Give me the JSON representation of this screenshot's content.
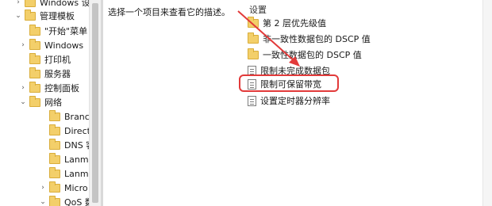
{
  "tree": {
    "items": [
      {
        "label": "Windows 设",
        "chevron": ">",
        "icon": "folder-icon"
      },
      {
        "label": "管理模板",
        "chevron": "v",
        "icon": "folder-icon"
      },
      {
        "label": "\"开始\"菜单",
        "chevron": "",
        "icon": "folder-icon"
      },
      {
        "label": "Windows",
        "chevron": ">",
        "icon": "folder-icon"
      },
      {
        "label": "打印机",
        "chevron": "",
        "icon": "folder-icon"
      },
      {
        "label": "服务器",
        "chevron": "",
        "icon": "folder-icon"
      },
      {
        "label": "控制面板",
        "chevron": ">",
        "icon": "folder-icon"
      },
      {
        "label": "网络",
        "chevron": "v",
        "icon": "folder-icon"
      },
      {
        "label": "Branc",
        "chevron": "",
        "icon": "folder-icon"
      },
      {
        "label": "Direct",
        "chevron": "",
        "icon": "folder-icon"
      },
      {
        "label": "DNS 客",
        "chevron": "",
        "icon": "folder-icon"
      },
      {
        "label": "Lanma",
        "chevron": "",
        "icon": "folder-icon"
      },
      {
        "label": "Lanma",
        "chevron": "",
        "icon": "folder-icon"
      },
      {
        "label": "Micro",
        "chevron": ">",
        "icon": "folder-icon"
      },
      {
        "label": "QoS 数",
        "chevron": "v",
        "icon": "folder-icon"
      }
    ]
  },
  "description": {
    "text": "选择一个项目来查看它的描述。"
  },
  "settings": {
    "header": "设置",
    "items": [
      {
        "label": "第 2 层优先级值",
        "icon": "folder-icon"
      },
      {
        "label": "非一致性数据包的 DSCP 值",
        "icon": "folder-icon"
      },
      {
        "label": "一致性数据包的 DSCP 值",
        "icon": "folder-icon"
      },
      {
        "label": "限制未完成数据包",
        "icon": "policy-setting-icon"
      },
      {
        "label": "限制可保留带宽",
        "icon": "policy-setting-icon"
      },
      {
        "label": "设置定时器分辨率",
        "icon": "policy-setting-icon"
      }
    ]
  },
  "annotation": {
    "highlight_color": "#e23a3a"
  }
}
